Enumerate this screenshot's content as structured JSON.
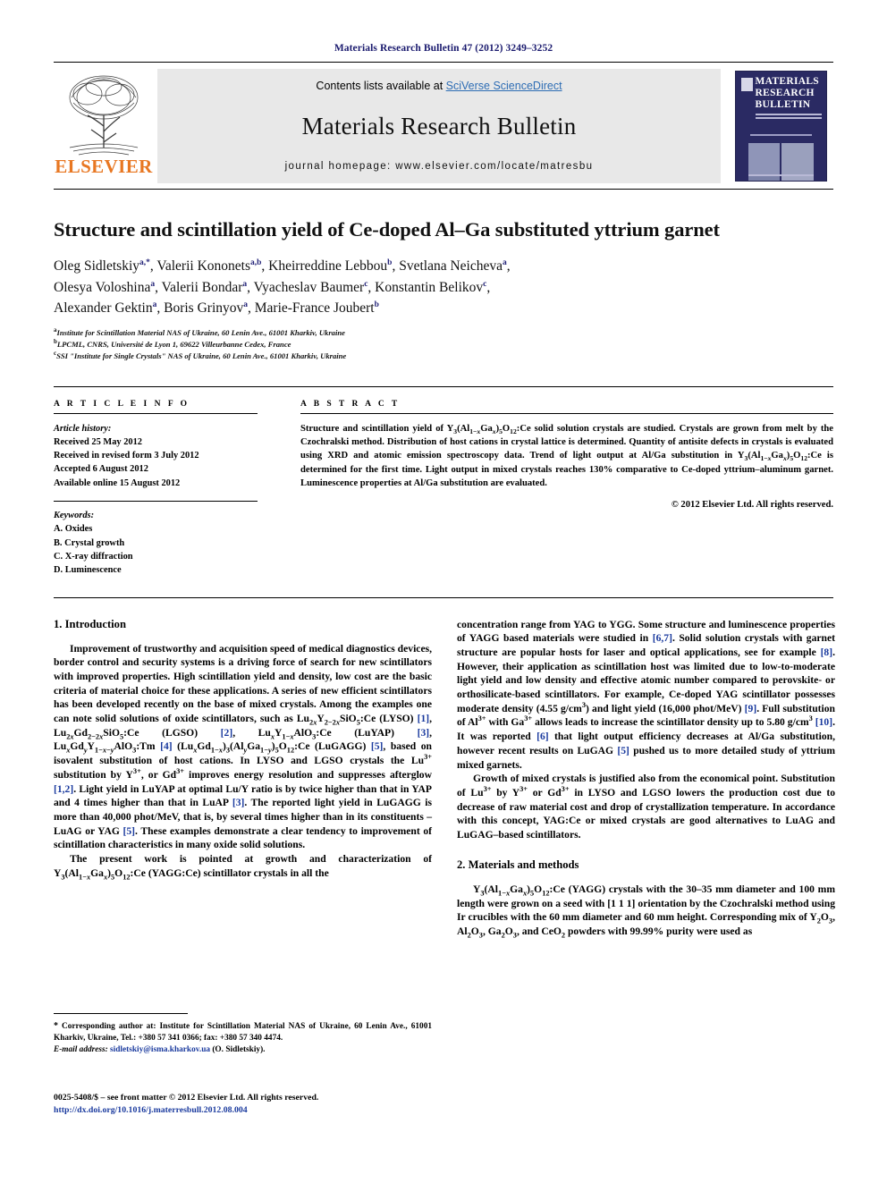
{
  "running_head": "Materials Research Bulletin 47 (2012) 3249–3252",
  "masthead": {
    "publisher_name": "ELSEVIER",
    "contents_prefix": "Contents lists available at ",
    "contents_link": "SciVerse ScienceDirect",
    "journal_name": "Materials Research Bulletin",
    "homepage": "journal homepage: www.elsevier.com/locate/matresbu",
    "cover_title_line1": "MATERIALS",
    "cover_title_line2": "RESEARCH",
    "cover_title_line3": "BULLETIN"
  },
  "article": {
    "title": "Structure and scintillation yield of Ce-doped Al–Ga substituted yttrium garnet",
    "authors_line1": "Oleg Sidletskiy",
    "authors_line1_sup": "a,*",
    "authors": [
      {
        "name": "Oleg Sidletskiy",
        "sup": "a,*"
      },
      {
        "name": "Valerii Kononets",
        "sup": "a,b"
      },
      {
        "name": "Kheirreddine Lebbou",
        "sup": "b"
      },
      {
        "name": "Svetlana Neicheva",
        "sup": "a"
      },
      {
        "name": "Olesya Voloshina",
        "sup": "a"
      },
      {
        "name": "Valerii Bondar",
        "sup": "a"
      },
      {
        "name": "Vyacheslav Baumer",
        "sup": "c"
      },
      {
        "name": "Konstantin Belikov",
        "sup": "c"
      },
      {
        "name": "Alexander Gektin",
        "sup": "a"
      },
      {
        "name": "Boris Grinyov",
        "sup": "a"
      },
      {
        "name": "Marie-France Joubert",
        "sup": "b"
      }
    ],
    "affiliations": [
      {
        "sup": "a",
        "text": "Institute for Scintillation Material NAS of Ukraine, 60 Lenin Ave., 61001 Kharkiv, Ukraine"
      },
      {
        "sup": "b",
        "text": "LPCML, CNRS, Université de Lyon 1, 69622 Villeurbanne Cedex, France"
      },
      {
        "sup": "c",
        "text": "SSI \"Institute for Single Crystals\" NAS of Ukraine, 60 Lenin Ave., 61001 Kharkiv, Ukraine"
      }
    ]
  },
  "info": {
    "heading": "A R T I C L E   I N F O",
    "history_label": "Article history:",
    "history": [
      "Received 25 May 2012",
      "Received in revised form 3 July 2012",
      "Accepted 6 August 2012",
      "Available online 15 August 2012"
    ],
    "keywords_label": "Keywords:",
    "keywords": [
      "A. Oxides",
      "B. Crystal growth",
      "C. X-ray diffraction",
      "D. Luminescence"
    ]
  },
  "abstract": {
    "heading": "A B S T R A C T",
    "copyright": "© 2012 Elsevier Ltd. All rights reserved."
  },
  "sections": {
    "introduction_title": "1. Introduction",
    "materials_title": "2. Materials and methods"
  },
  "footnote": {
    "star": "*",
    "text": " Corresponding author at: Institute for Scintillation Material NAS of Ukraine, 60 Lenin Ave., 61001 Kharkiv, Ukraine, Tel.: +380 57 341 0366; fax: +380 57 340 4474.",
    "email_label": "E-mail address:",
    "email": "sidletskiy@isma.kharkov.ua",
    "email_owner": " (O. Sidletskiy)."
  },
  "issn": {
    "line": "0025-5408/$ – see front matter © 2012 Elsevier Ltd. All rights reserved.",
    "doi": "http://dx.doi.org/10.1016/j.materresbull.2012.08.004"
  }
}
